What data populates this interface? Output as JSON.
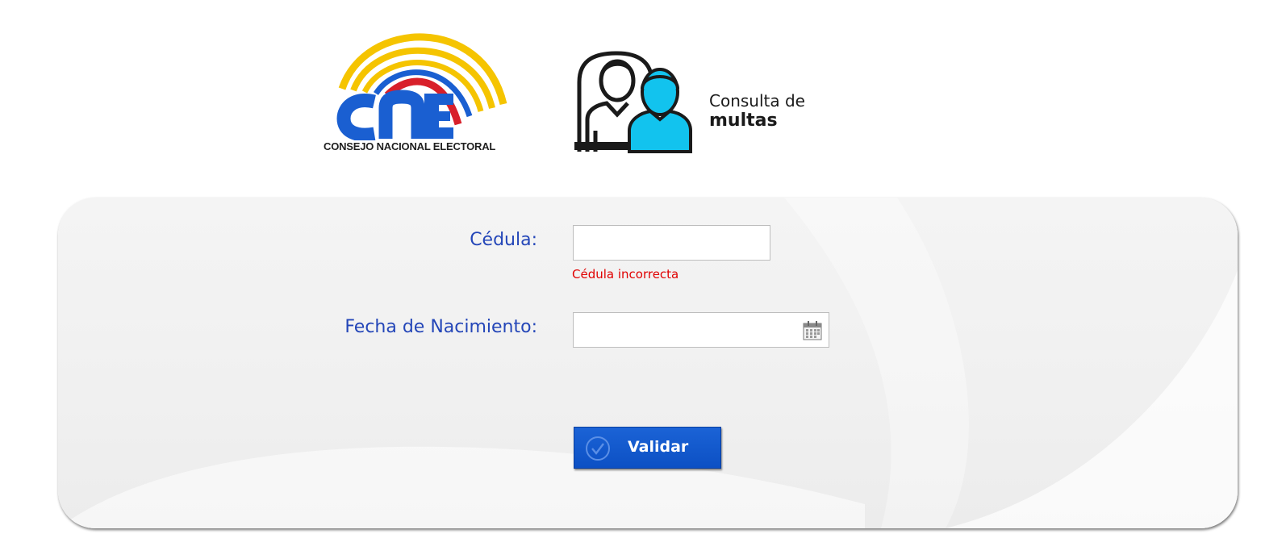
{
  "header": {
    "logo_text": "CNE",
    "logo_subtitle": "CONSEJO NACIONAL ELECTORAL",
    "title_line1": "Consulta de",
    "title_line2": "multas"
  },
  "form": {
    "cedula_label": "Cédula:",
    "cedula_value": "",
    "cedula_error": "Cédula incorrecta",
    "fecha_label": "Fecha de Nacimiento:",
    "fecha_value": "",
    "submit_label": "Validar"
  },
  "colors": {
    "label_blue": "#2446b8",
    "error_red": "#e00000",
    "button_blue": "#0c50c4",
    "logo_blue": "#1a5fd1",
    "logo_yellow": "#f5c400",
    "logo_red": "#d8202a",
    "icon_cyan": "#12c3ee"
  },
  "icons": {
    "logo_arcs": "rainbow-arcs",
    "consulta": "two-people-icon",
    "calendar": "calendar-icon",
    "submit": "check-circle-icon"
  }
}
